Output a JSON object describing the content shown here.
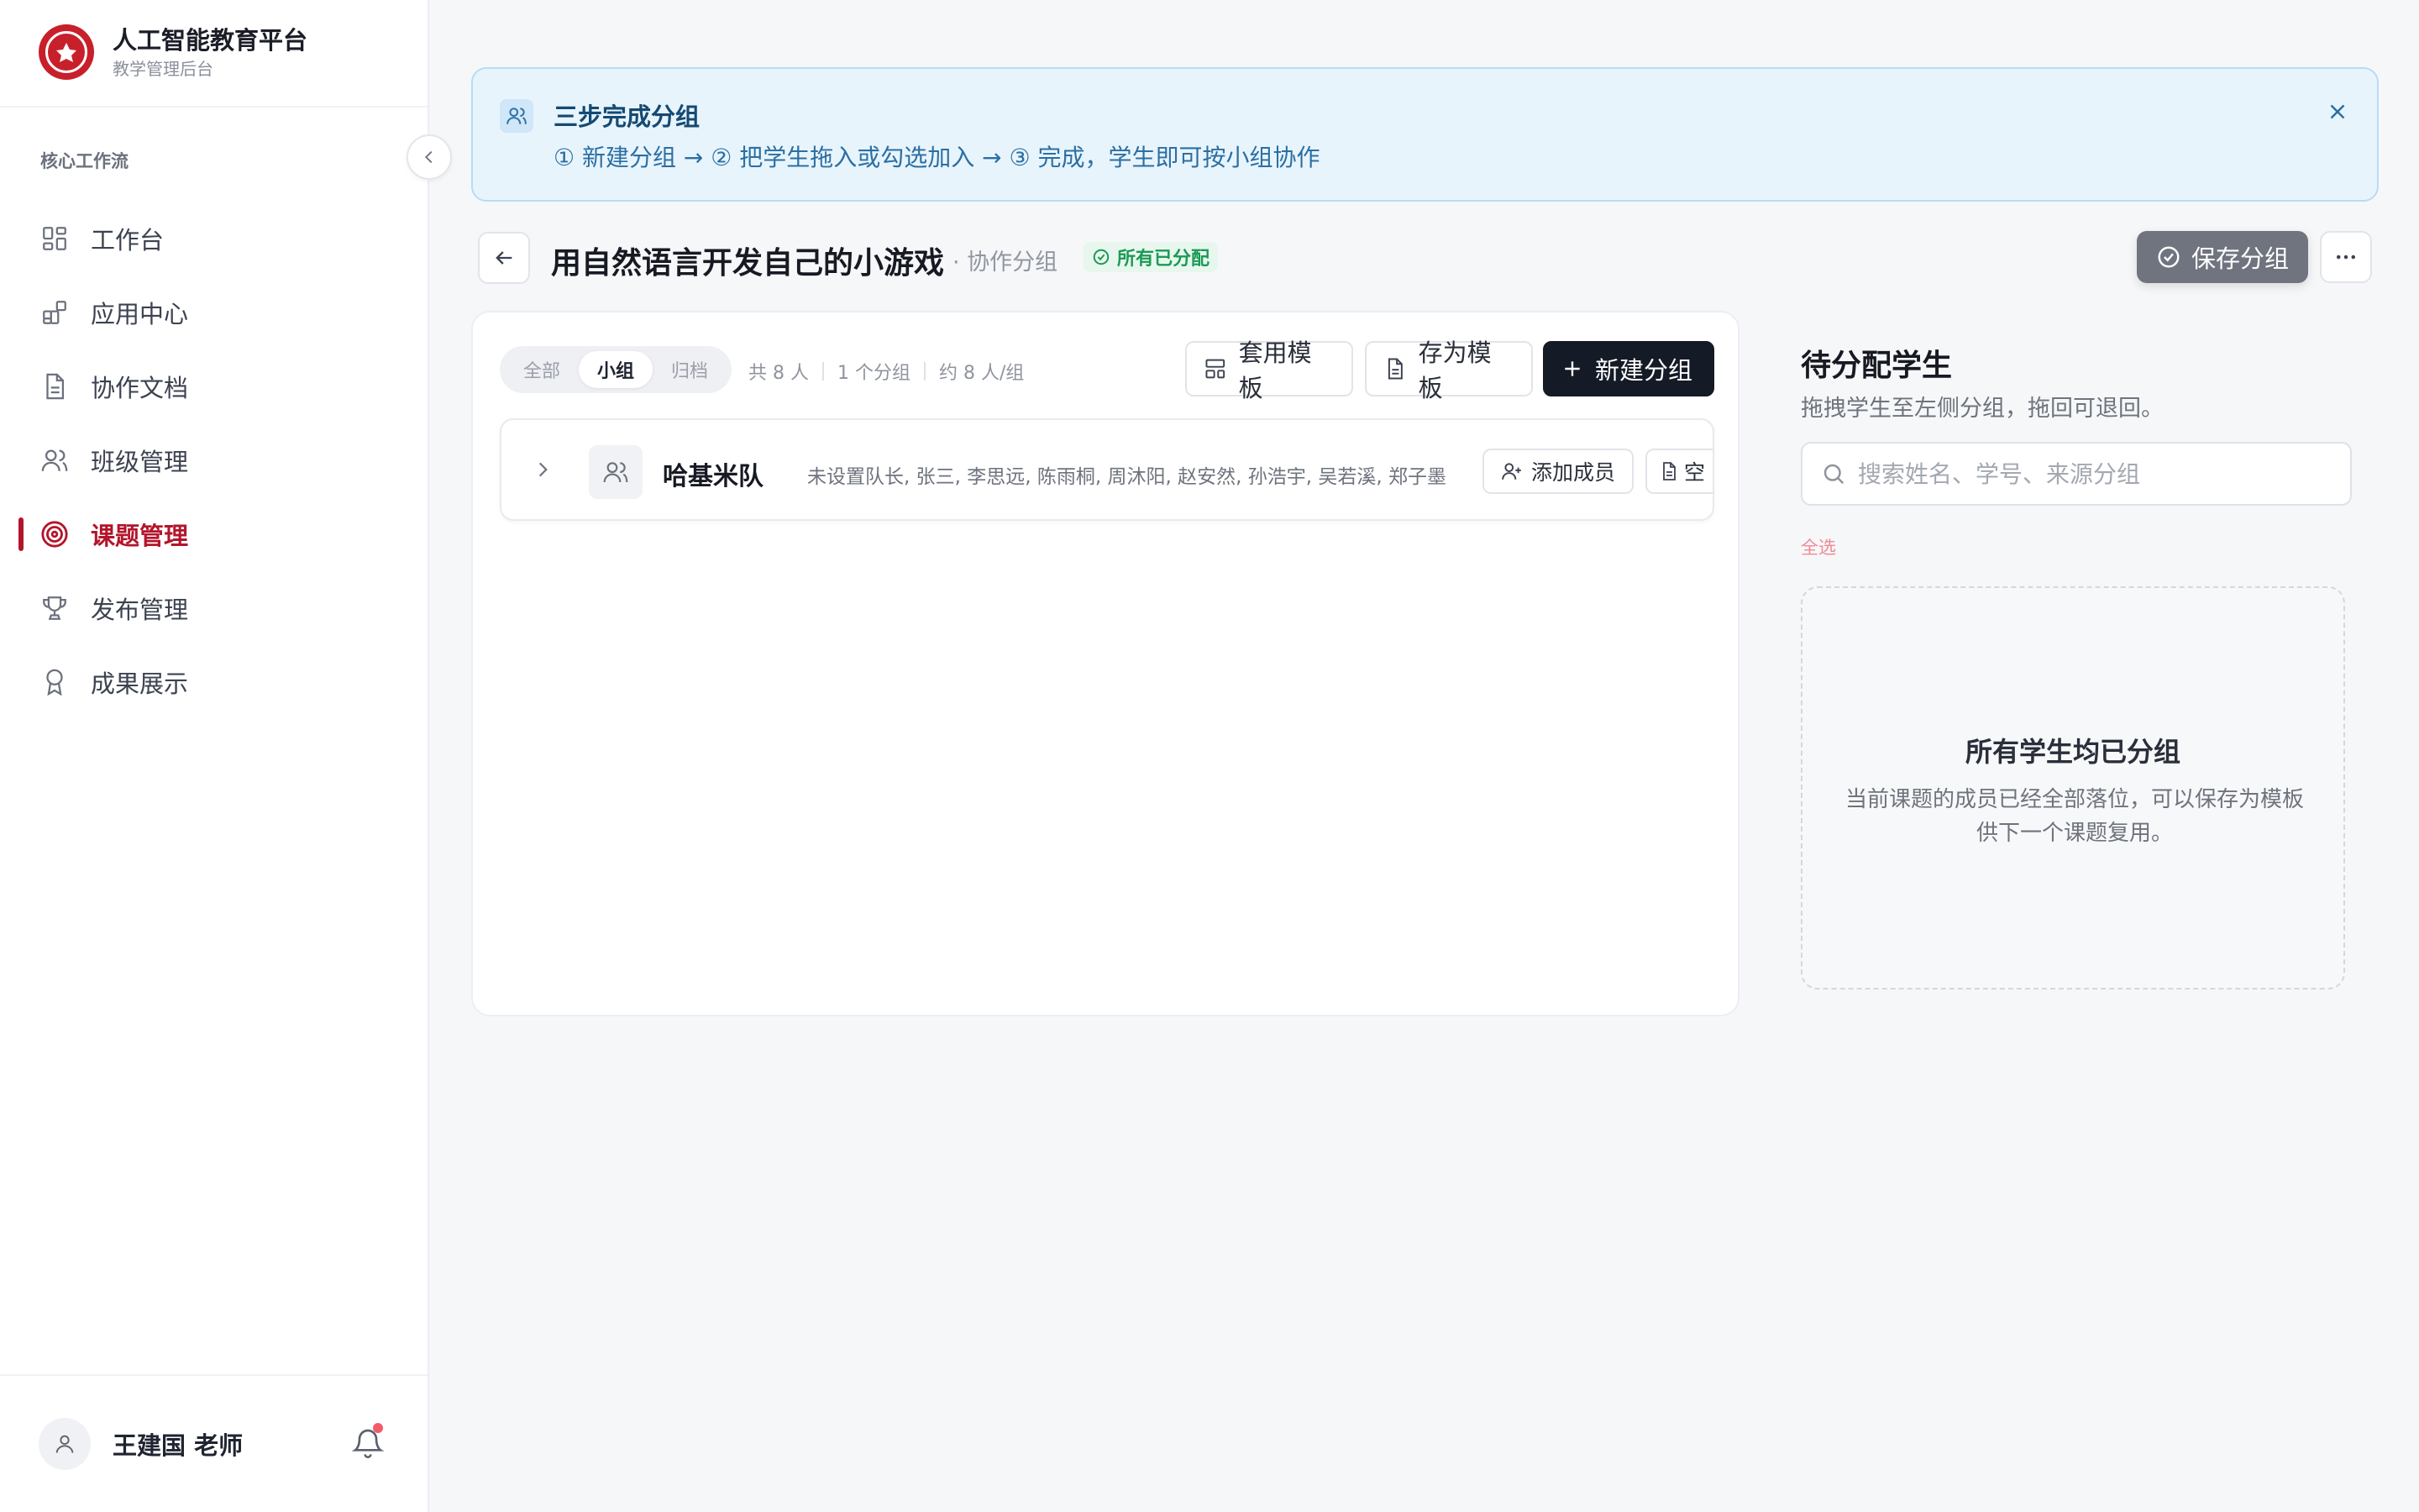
{
  "brand": {
    "title": "人工智能教育平台",
    "subtitle": "教学管理后台"
  },
  "sidebar": {
    "section_label": "核心工作流",
    "items": [
      {
        "label": "工作台",
        "icon": "dashboard-icon",
        "active": false
      },
      {
        "label": "应用中心",
        "icon": "apps-icon",
        "active": false
      },
      {
        "label": "协作文档",
        "icon": "document-icon",
        "active": false
      },
      {
        "label": "班级管理",
        "icon": "users-icon",
        "active": false
      },
      {
        "label": "课题管理",
        "icon": "target-icon",
        "active": true
      },
      {
        "label": "发布管理",
        "icon": "trophy-icon",
        "active": false
      },
      {
        "label": "成果展示",
        "icon": "award-icon",
        "active": false
      }
    ],
    "user": {
      "name": "王建国 老师",
      "has_notification": true
    }
  },
  "banner": {
    "title": "三步完成分组",
    "steps": "① 新建分组 → ② 把学生拖入或勾选加入 → ③ 完成，学生即可按小组协作"
  },
  "header": {
    "title": "用自然语言开发自己的小游戏",
    "subtitle": "· 协作分组",
    "status": "所有已分配",
    "save_label": "保存分组"
  },
  "groups_panel": {
    "tabs": [
      {
        "label": "全部",
        "active": false
      },
      {
        "label": "小组",
        "active": true
      },
      {
        "label": "归档",
        "active": false
      }
    ],
    "stats": [
      "共 8 人",
      "1 个分组",
      "约 8 人/组"
    ],
    "apply_template_label": "套用模板",
    "save_template_label": "存为模板",
    "new_group_label": "新建分组",
    "groups": [
      {
        "name": "哈基米队",
        "members": "未设置队长, 张三, 李思远, 陈雨桐, 周沐阳, 赵安然, 孙浩宇, 吴若溪, 郑子墨",
        "add_member_label": "添加成员",
        "clipped_label": "空"
      }
    ]
  },
  "unassigned": {
    "title": "待分配学生",
    "description": "拖拽学生至左侧分组，拖回可退回。",
    "search_placeholder": "搜索姓名、学号、来源分组",
    "select_all": "全选",
    "empty_title": "所有学生均已分组",
    "empty_text": "当前课题的成员已经全部落位，可以保存为模板供下一个课题复用。"
  },
  "colors": {
    "brand_red": "#c8202b",
    "active_nav": "#b3152b",
    "banner_bg": "#e8f4fc",
    "primary_dark": "#141a26",
    "success_green": "#1b9a55"
  }
}
